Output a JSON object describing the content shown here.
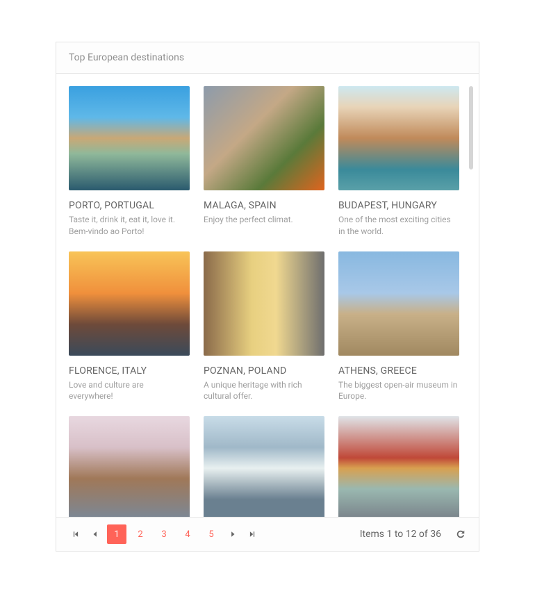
{
  "header": {
    "title": "Top European destinations"
  },
  "cards": [
    {
      "title": "PORTO, PORTUGAL",
      "desc": "Taste it, drink it, eat it, love it. Bem-vindo ao Porto!",
      "img": "porto"
    },
    {
      "title": "MALAGA, SPAIN",
      "desc": "Enjoy the perfect climat.",
      "img": "malaga"
    },
    {
      "title": "BUDAPEST, HUNGARY",
      "desc": "One of the most exciting cities in the world.",
      "img": "budapest"
    },
    {
      "title": "FLORENCE, ITALY",
      "desc": "Love and culture are everywhere!",
      "img": "florence"
    },
    {
      "title": "POZNAN, POLAND",
      "desc": "A unique heritage with rich cultural offer.",
      "img": "poznan"
    },
    {
      "title": "ATHENS, GREECE",
      "desc": "The biggest open-air museum in Europe.",
      "img": "athens"
    },
    {
      "title": "",
      "desc": "",
      "img": "bordeaux"
    },
    {
      "title": "",
      "desc": "",
      "img": "geneva"
    },
    {
      "title": "",
      "desc": "",
      "img": "copenhagen"
    }
  ],
  "pager": {
    "pages": [
      "1",
      "2",
      "3",
      "4",
      "5"
    ],
    "active_page": "1",
    "info": "Items 1 to 12 of 36"
  },
  "colors": {
    "accent": "#ff6358"
  }
}
